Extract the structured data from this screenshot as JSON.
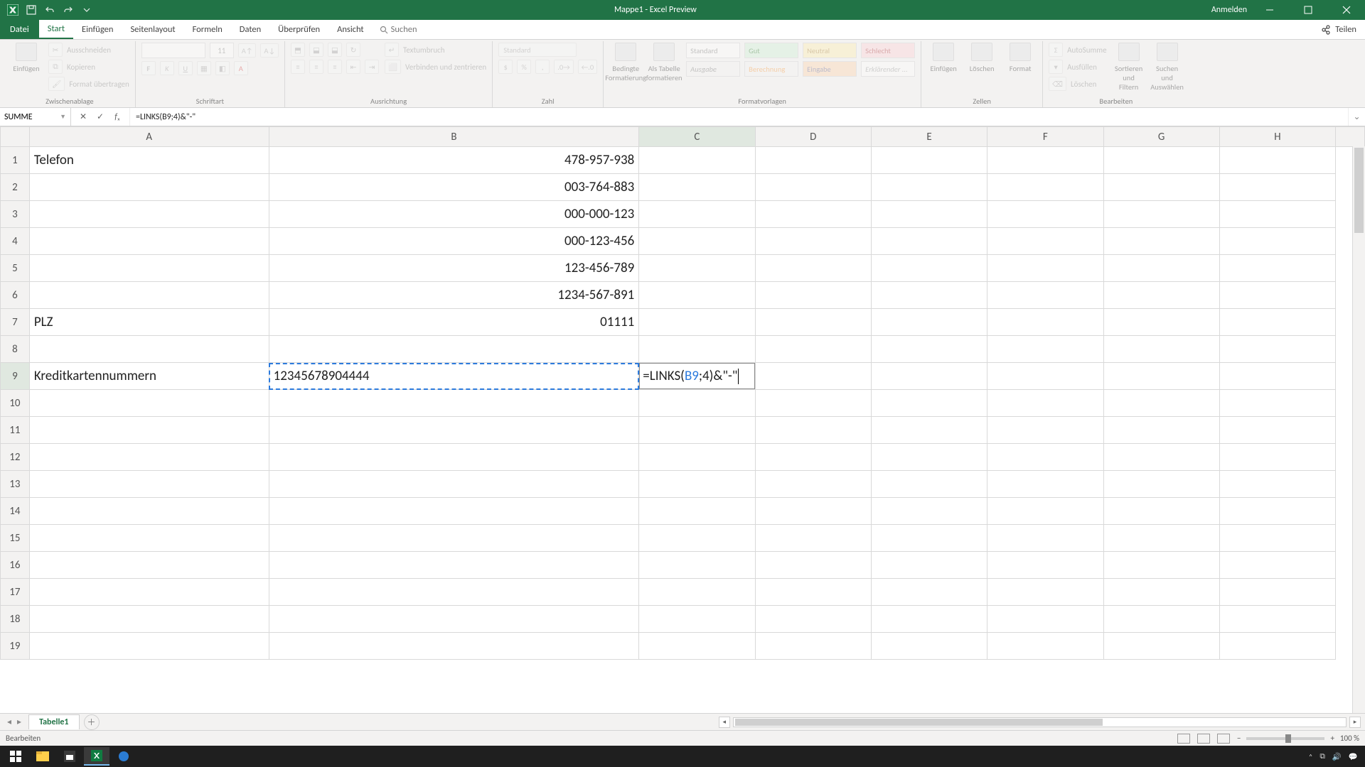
{
  "titlebar": {
    "title": "Mappe1 - Excel Preview",
    "signin": "Anmelden"
  },
  "tabs": {
    "file": "Datei",
    "items": [
      "Start",
      "Einfügen",
      "Seitenlayout",
      "Formeln",
      "Daten",
      "Überprüfen",
      "Ansicht"
    ],
    "active": "Start",
    "tellme": "Suchen",
    "share": "Teilen"
  },
  "ribbon": {
    "paste": "Einfügen",
    "cut": "Ausschneiden",
    "copy": "Kopieren",
    "formatpainter": "Format übertragen",
    "group_clip": "Zwischenablage",
    "font_name": "",
    "font_size": "11",
    "group_font": "Schriftart",
    "wrap": "Textumbruch",
    "merge": "Verbinden und zentrieren",
    "group_align": "Ausrichtung",
    "numfmt": "Standard",
    "group_num": "Zahl",
    "condfmt": "Bedingte Formatierung",
    "astable": "Als Tabelle formatieren",
    "styles": {
      "standard": "Standard",
      "gut": "Gut",
      "neutral": "Neutral",
      "schlecht": "Schlecht",
      "ausgabe": "Ausgabe",
      "berechnung": "Berechnung",
      "eingabe": "Eingabe",
      "erkl": "Erklärender ..."
    },
    "group_styles": "Formatvorlagen",
    "insert": "Einfügen",
    "delete": "Löschen",
    "format": "Format",
    "group_cells": "Zellen",
    "autosum": "AutoSumme",
    "fill": "Ausfüllen",
    "clear": "Löschen",
    "sortfilter": "Sortieren und Filtern",
    "findselect": "Suchen und Auswählen",
    "group_edit": "Bearbeiten"
  },
  "fbar": {
    "namebox": "SUMME",
    "formula": "=LINKS(B9;4)&\"-\""
  },
  "columns": [
    "A",
    "B",
    "C",
    "D",
    "E",
    "F",
    "G",
    "H"
  ],
  "active_col": "C",
  "active_row": 9,
  "cells": {
    "A1": "Telefon",
    "B1": "478-957-938",
    "B2": "003-764-883",
    "B3": "000-000-123",
    "B4": "000-123-456",
    "B5": "123-456-789",
    "B6": "1234-567-891",
    "A7": "PLZ",
    "B7": "01111",
    "A9": "Kreditkartennummern",
    "B9": "12345678904444"
  },
  "edit_cell": {
    "prefix": "=LINKS(",
    "ref": "B9",
    "mid": ";4)&",
    "tail": "\"-\""
  },
  "sheettab": "Tabelle1",
  "status": {
    "mode": "Bearbeiten",
    "zoom": "100 %"
  }
}
